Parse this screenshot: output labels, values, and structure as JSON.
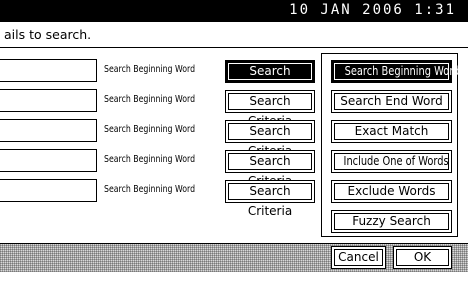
{
  "header": {
    "datetime": "10 JAN  2006  1:31"
  },
  "instruction": "ails to search.",
  "rows": [
    {
      "field_value": "",
      "mode_label": "Search Beginning Word",
      "criteria_button": "Search Criteria",
      "selected": true
    },
    {
      "field_value": "",
      "mode_label": "Search Beginning Word",
      "criteria_button": "Search Criteria",
      "selected": false
    },
    {
      "field_value": "",
      "mode_label": "Search Beginning Word",
      "criteria_button": "Search Criteria",
      "selected": false
    },
    {
      "field_value": "",
      "mode_label": "Search Beginning Word",
      "criteria_button": "Search Criteria",
      "selected": false
    },
    {
      "field_value": "",
      "mode_label": "Search Beginning Word",
      "criteria_button": "Search Criteria",
      "selected": false
    }
  ],
  "criteria_options": [
    {
      "label": "Search Beginning Word",
      "selected": true
    },
    {
      "label": "Search End Word",
      "selected": false
    },
    {
      "label": "Exact Match",
      "selected": false
    },
    {
      "label": "Include One of Words",
      "selected": false
    },
    {
      "label": "Exclude Words",
      "selected": false
    },
    {
      "label": "Fuzzy Search",
      "selected": false
    }
  ],
  "footer": {
    "cancel_label": "Cancel",
    "ok_label": "OK"
  }
}
